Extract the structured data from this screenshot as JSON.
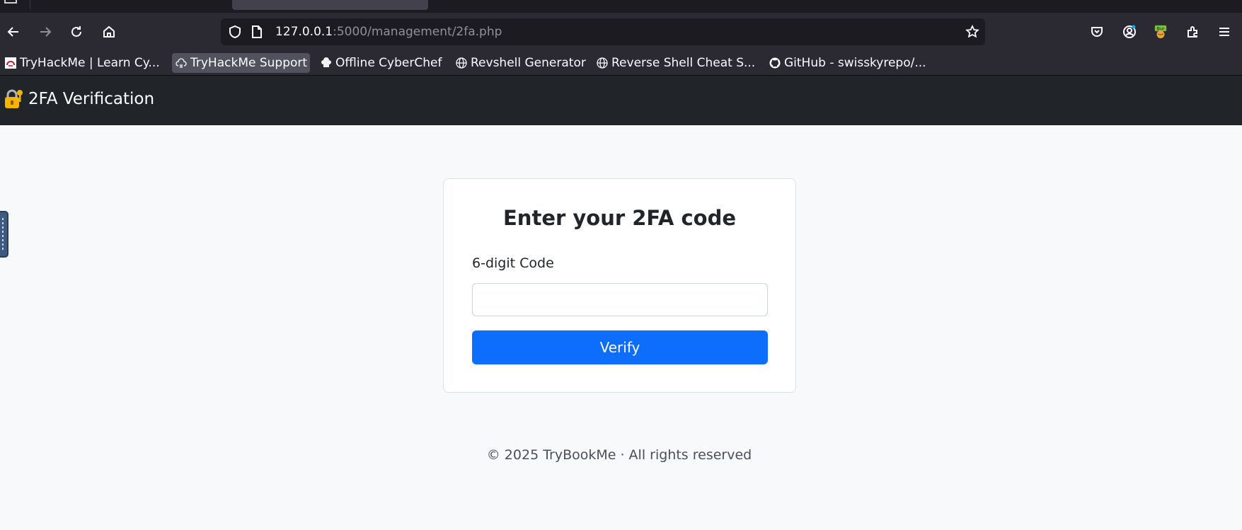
{
  "browser": {
    "url_host": "127.0.0.1",
    "url_path": ":5000/management/2fa.php",
    "bookmarks": [
      {
        "label": "TryHackMe | Learn Cy...",
        "icon": "tryhackme-icon"
      },
      {
        "label": "TryHackMe Support",
        "icon": "support-cloud-icon"
      },
      {
        "label": "Offline CyberChef",
        "icon": "chef-hat-icon"
      },
      {
        "label": "Revshell Generator",
        "icon": "globe-icon"
      },
      {
        "label": "Reverse Shell Cheat S...",
        "icon": "globe-icon"
      },
      {
        "label": "GitHub - swisskyrepo/...",
        "icon": "github-icon"
      }
    ],
    "burp_badge": "Burp"
  },
  "site": {
    "brand": "2FA Verification",
    "brand_icon": "lock-with-key-icon"
  },
  "form": {
    "title": "Enter your 2FA code",
    "code_label": "6-digit Code",
    "code_value": "",
    "verify_label": "Verify"
  },
  "footer": {
    "text": "© 2025 TryBookMe · All rights reserved"
  },
  "colors": {
    "navbar": "#212529",
    "page_bg": "#f8f9fa",
    "primary_button": "#0d6efd",
    "browser_toolbar": "#2b2a33"
  }
}
